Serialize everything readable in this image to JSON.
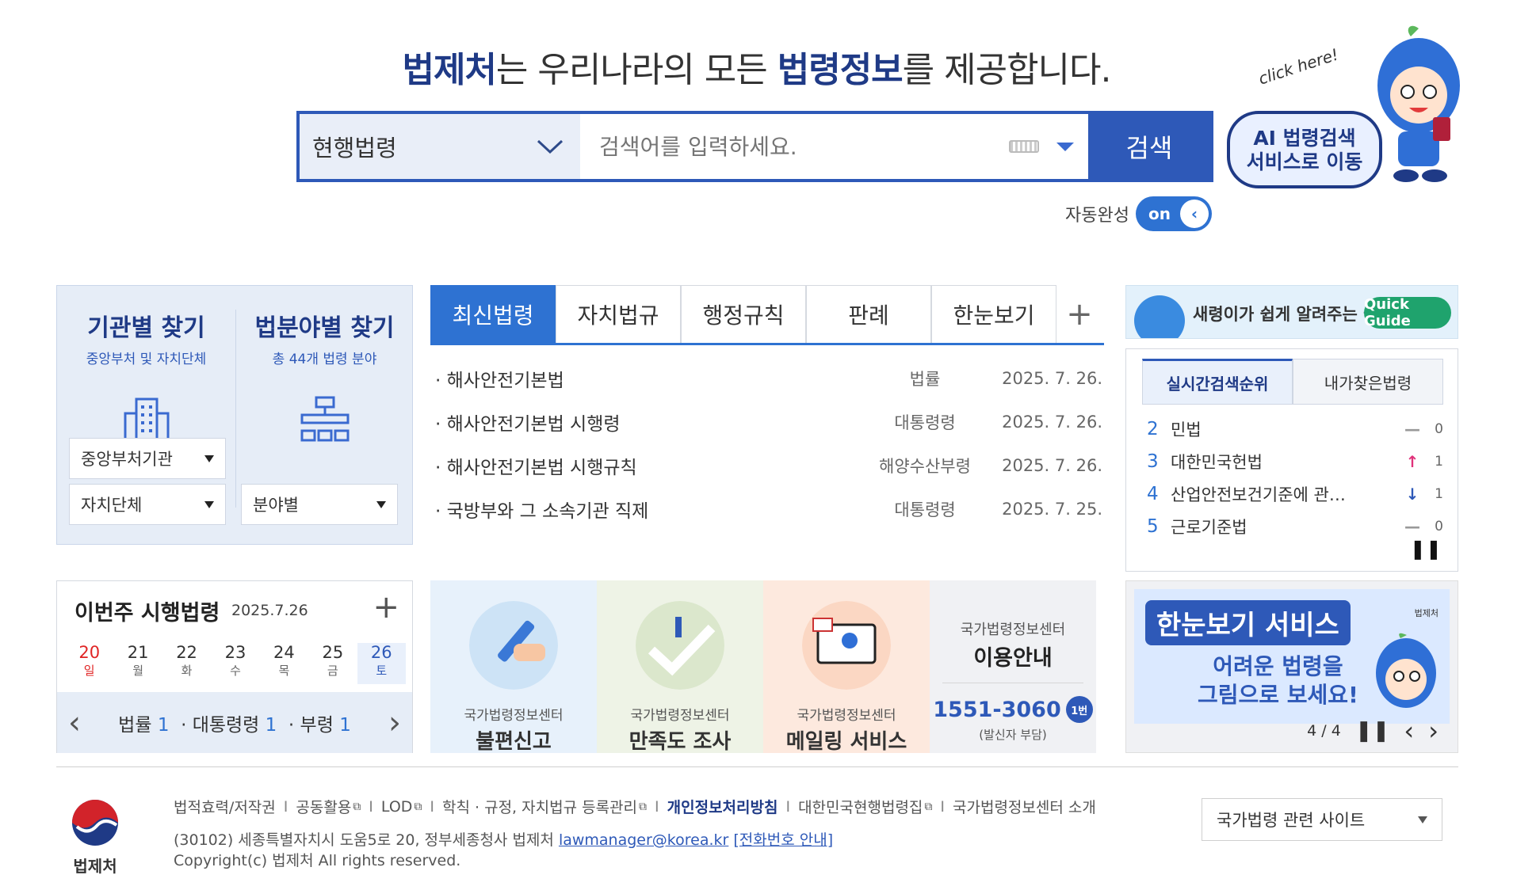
{
  "headline": {
    "part1": "법제처",
    "part2": "는 우리나라의 모든 ",
    "part3": "법령정보",
    "part4": "를 제공합니다."
  },
  "search": {
    "scope_value": "현행법령",
    "placeholder": "검색어를 입력하세요.",
    "button_label": "검색",
    "autocomplete_label": "자동완성",
    "toggle_state": "on"
  },
  "ai_banner": {
    "click_text": "click here!",
    "line1": "AI 법령검색",
    "line2": "서비스로 이동"
  },
  "agency_finder": {
    "title": "기관별 찾기",
    "subtitle": "중앙부처 및 자치단체",
    "select1": "중앙부처기관",
    "select2": "자치단체"
  },
  "field_finder": {
    "title": "법분야별 찾기",
    "subtitle": "총 44개 법령 분야",
    "select": "분야별"
  },
  "tabs": [
    "최신법령",
    "자치법규",
    "행정규칙",
    "판례",
    "한눈보기"
  ],
  "latest_laws": [
    {
      "title": "해사안전기본법",
      "kind": "법률",
      "date": "2025. 7. 26."
    },
    {
      "title": "해사안전기본법 시행령",
      "kind": "대통령령",
      "date": "2025. 7. 26."
    },
    {
      "title": "해사안전기본법 시행규칙",
      "kind": "해양수산부령",
      "date": "2025. 7. 26."
    },
    {
      "title": "국방부와 그 소속기관 직제",
      "kind": "대통령령",
      "date": "2025. 7. 25."
    }
  ],
  "quick_guide": {
    "text": "새령이가 쉽게 알려주는 국법",
    "button": "Quick Guide"
  },
  "ranking": {
    "tab_realtime": "실시간검색순위",
    "tab_mine": "내가찾은법령",
    "items": [
      {
        "rank": "2",
        "label": "민법",
        "change": "—",
        "count": "0"
      },
      {
        "rank": "3",
        "label": "대한민국헌법",
        "change": "↑",
        "count": "1"
      },
      {
        "rank": "4",
        "label": "산업안전보건기준에 관…",
        "change": "↓",
        "count": "1"
      },
      {
        "rank": "5",
        "label": "근로기준법",
        "change": "—",
        "count": "0"
      }
    ],
    "pause": "❚❚"
  },
  "week": {
    "title": "이번주 시행법령",
    "date": "2025.7.26",
    "plus": "+",
    "days": [
      {
        "num": "20",
        "dow": "일"
      },
      {
        "num": "21",
        "dow": "월"
      },
      {
        "num": "22",
        "dow": "화"
      },
      {
        "num": "23",
        "dow": "수"
      },
      {
        "num": "24",
        "dow": "목"
      },
      {
        "num": "25",
        "dow": "금"
      },
      {
        "num": "26",
        "dow": "토"
      }
    ],
    "law_label": "법률",
    "law_count": "1",
    "decree_label": "· 대통령령",
    "decree_count": "1",
    "ministry_label": "· 부령",
    "ministry_count": "1"
  },
  "services": [
    {
      "top": "국가법령정보센터",
      "main": "불편신고"
    },
    {
      "top": "국가법령정보센터",
      "main": "만족도 조사"
    },
    {
      "top": "국가법령정보센터",
      "main": "메일링 서비스"
    }
  ],
  "info_center": {
    "top": "국가법령정보센터",
    "main": "이용안내",
    "phone": "1551-3060",
    "badge": "1번",
    "note": "(발신자 부담)"
  },
  "promo": {
    "title": "한눈보기 서비스",
    "line1": "어려운 법령을",
    "line2": "그림으로 보세요!",
    "org": "법제처",
    "page": "4 / 4"
  },
  "footer": {
    "links": [
      "법적효력/저작권",
      "공동활용",
      "LOD",
      "학칙 · 규정, 자치법규 등록관리",
      "개인정보처리방침",
      "대한민국현행법령집",
      "국가법령정보센터 소개"
    ],
    "address": "(30102) 세종특별자치시 도움5로 20, 정부세종청사 법제처",
    "email": "lawmanager@korea.kr",
    "phone_guide": "[전화번호 안내]",
    "copyright": "Copyright(c) 법제처 All rights reserved.",
    "logo_name": "법제처",
    "related_sites": "국가법령 관련 사이트"
  },
  "colors": {
    "primary": "#2e59b8",
    "accent": "#2e72d2",
    "navy": "#1f3a86",
    "sunday": "#e02424"
  }
}
